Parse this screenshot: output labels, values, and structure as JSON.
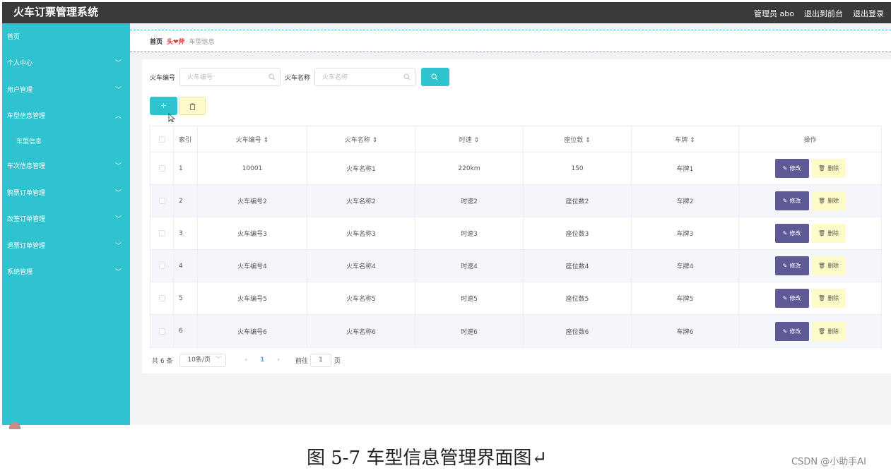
{
  "app": {
    "title": "火车订票管理系统",
    "top_links": {
      "admin": "管理员 abo",
      "to_front": "退出到前台",
      "logout": "退出登录"
    }
  },
  "sidebar": {
    "items": [
      {
        "label": "首页"
      },
      {
        "label": "个人中心",
        "chevron": "﹀"
      },
      {
        "label": "用户管理",
        "chevron": "﹀"
      },
      {
        "label": "车型信息管理",
        "chevron": "︿"
      },
      {
        "label": "车型信息"
      },
      {
        "label": "车次信息管理",
        "chevron": "﹀"
      },
      {
        "label": "购票订单管理",
        "chevron": "﹀"
      },
      {
        "label": "改签订单管理",
        "chevron": "﹀"
      },
      {
        "label": "退票订单管理",
        "chevron": "﹀"
      },
      {
        "label": "系统管理",
        "chevron": "﹀"
      }
    ]
  },
  "breadcrumb": {
    "home": "首页",
    "separator": "头❤斧",
    "current": "车型信息"
  },
  "search": {
    "train_no_label": "火车编号",
    "train_no_placeholder": "火车编号",
    "train_name_label": "火车名称",
    "train_name_placeholder": "火车名称"
  },
  "actions": {
    "add_label": "+"
  },
  "table": {
    "headers": [
      "索引",
      "火车编号 ⇕",
      "火车名称 ⇕",
      "时速 ⇕",
      "座位数 ⇕",
      "车牌 ⇕",
      "操作"
    ],
    "rows": [
      [
        "1",
        "10001",
        "火车名称1",
        "220km",
        "150",
        "车牌1"
      ],
      [
        "2",
        "火车编号2",
        "火车名称2",
        "时速2",
        "座位数2",
        "车牌2"
      ],
      [
        "3",
        "火车编号3",
        "火车名称3",
        "时速3",
        "座位数3",
        "车牌3"
      ],
      [
        "4",
        "火车编号4",
        "火车名称4",
        "时速4",
        "座位数4",
        "车牌4"
      ],
      [
        "5",
        "火车编号5",
        "火车名称5",
        "时速5",
        "座位数5",
        "车牌5"
      ],
      [
        "6",
        "火车编号6",
        "火车名称6",
        "时速6",
        "座位数6",
        "车牌6"
      ]
    ],
    "edit_label": "修改",
    "delete_label": "删除"
  },
  "pagination": {
    "total": "共 6 条",
    "page_size": "10条/页",
    "current_page": "1",
    "goto_label": "前往",
    "goto_value": "1",
    "page_suffix": "页"
  },
  "caption": "图 5-7 车型信息管理界面图↵",
  "watermark": "CSDN @小助手AI",
  "colors": {
    "accent": "#2fc2cf",
    "topbar": "#3a3a3a",
    "edit_button": "#5e5a96",
    "delete_button": "#fffbc8"
  }
}
